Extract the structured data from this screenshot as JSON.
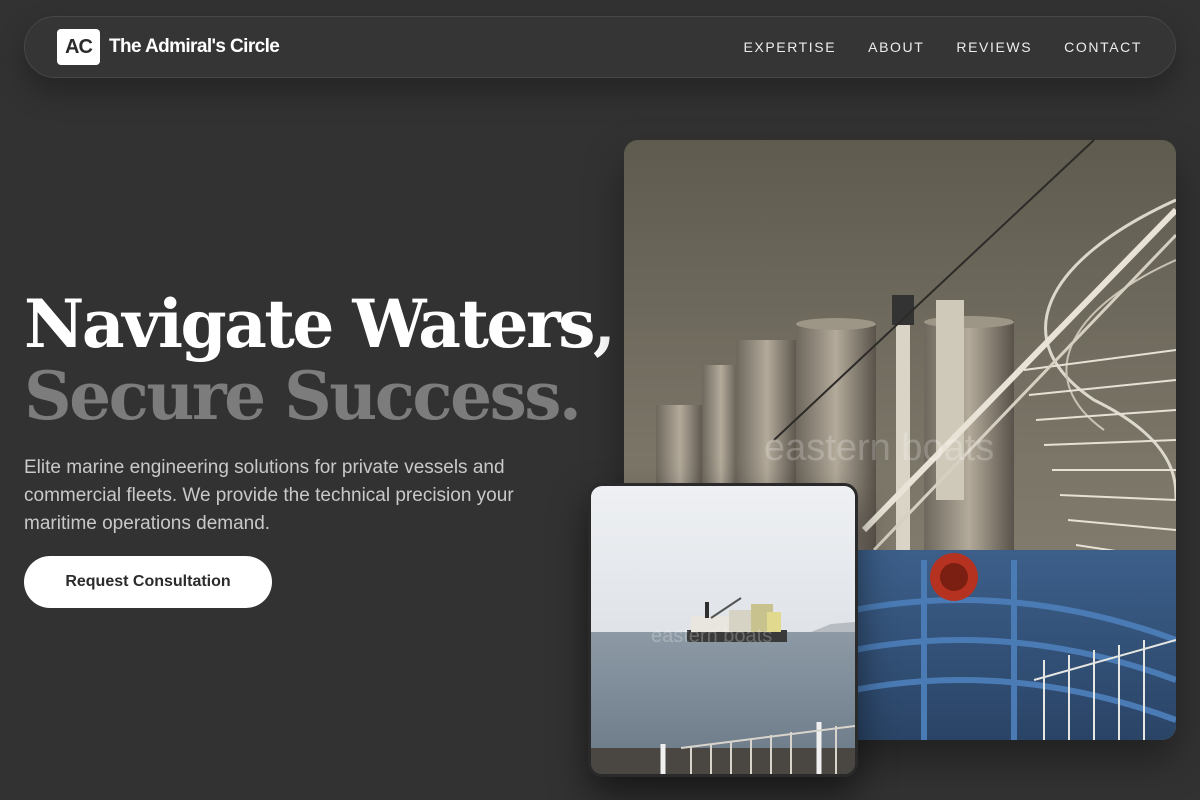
{
  "brand": {
    "logo": "AC",
    "name": "The Admiral's Circle"
  },
  "nav": {
    "links": [
      "EXPERTISE",
      "ABOUT",
      "REVIEWS",
      "CONTACT"
    ]
  },
  "hero": {
    "title_line1": "Navigate Waters,",
    "title_line2": "Secure Success.",
    "subtitle": "Elite marine engineering solutions for private vessels and commercial fleets. We provide the technical precision your maritime operations demand.",
    "cta_label": "Request Consultation"
  },
  "images": {
    "large_watermark": "eastern boats",
    "small_watermark": "eastern boats"
  },
  "colors": {
    "background": "#323232",
    "title_primary": "#ffffff",
    "title_secondary": "#7c7c7c",
    "cta_background": "#ffffff"
  }
}
